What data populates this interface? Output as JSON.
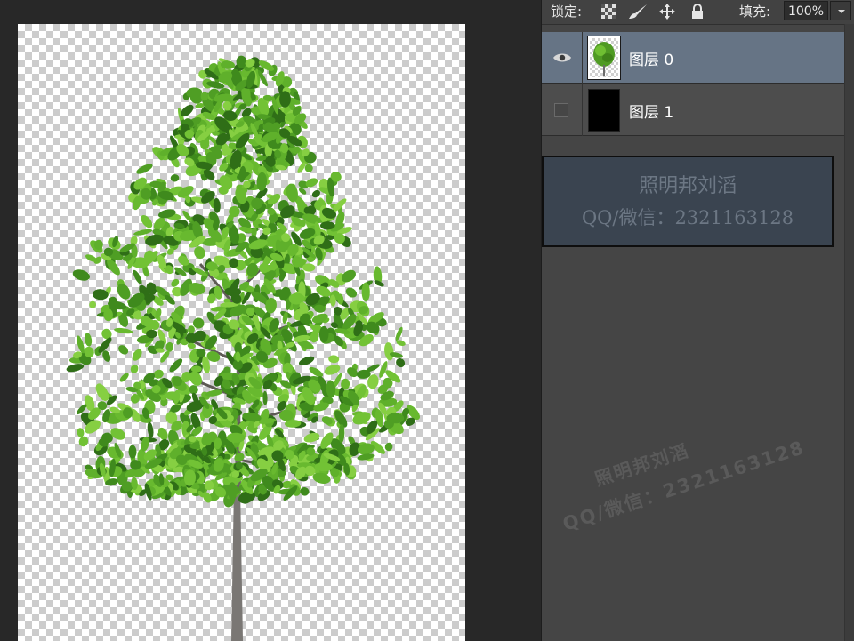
{
  "toolbar": {
    "lock_label": "锁定:",
    "lock_icons": [
      "lock-transparent-pixels-icon",
      "lock-image-pixels-icon",
      "lock-position-icon",
      "lock-all-icon"
    ],
    "fill_label": "填充:",
    "fill_value": "100%"
  },
  "layers": [
    {
      "name": "图层 0",
      "visible": true,
      "selected": true,
      "thumbnail": "tree-thumbnail"
    },
    {
      "name": "图层 1",
      "visible": false,
      "selected": false,
      "thumbnail": "black-fill-thumbnail"
    }
  ],
  "watermark": {
    "line1": "照明邦刘滔",
    "line2": "QQ/微信：2321163128",
    "diag_line1": "照明邦刘滔",
    "diag_line2": "QQ/微信：2321163128"
  },
  "colors": {
    "app_bg": "#282828",
    "panel_bg": "#454545",
    "selected_layer": "#667485",
    "watermark_box": "#3a4450",
    "foliage": "#5aa52a"
  }
}
